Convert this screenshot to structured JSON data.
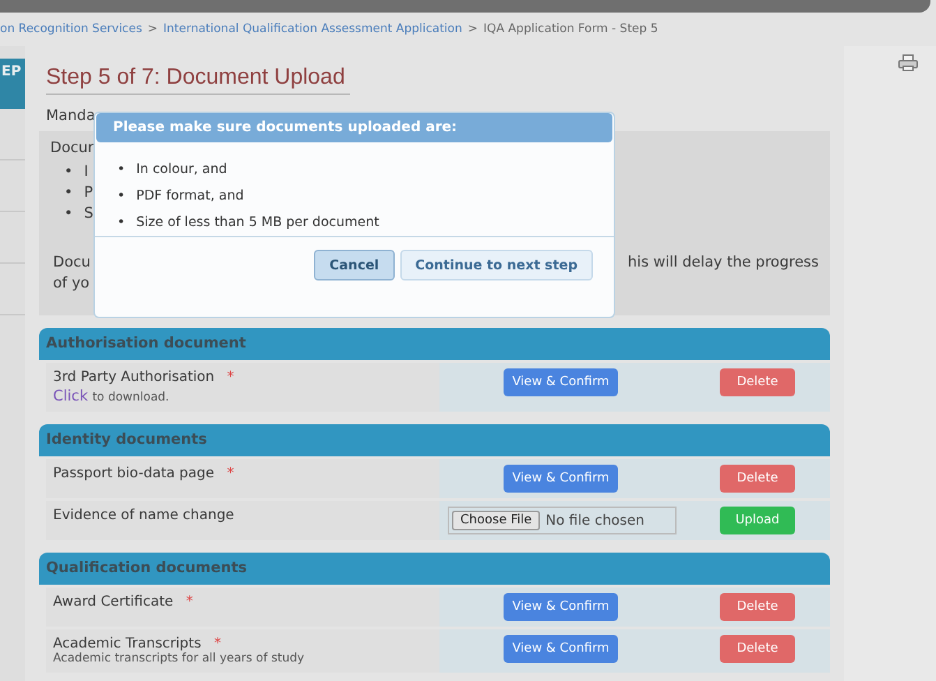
{
  "breadcrumb": [
    {
      "label": "on Recognition Services",
      "kind": "link"
    },
    {
      "label": ">",
      "kind": "separator"
    },
    {
      "label": "International Qualification Assessment Application",
      "kind": "link"
    },
    {
      "label": ">",
      "kind": "separator"
    },
    {
      "label": "IQA Application Form - Step 5",
      "kind": "current"
    }
  ],
  "sidebar": {
    "label": "EP"
  },
  "page_title": "Step 5 of 7: Document Upload",
  "mandatory_fragment": "Manda",
  "info": {
    "heading_fragment": "Docur",
    "bullet_fragments": [
      {
        "marker": "•",
        "text": "I"
      },
      {
        "marker": "•",
        "text": "P"
      },
      {
        "marker": "•",
        "text": "S"
      }
    ],
    "note_fragment_start": "Docu",
    "note_fragment_end": "his will delay the progress",
    "note_fragment_line2": "of yo"
  },
  "sections": [
    {
      "title": "Authorisation document",
      "rows": [
        {
          "kind": "document",
          "label": "3rd Party Authorisation",
          "asterisk": "*",
          "link": "Click",
          "hint": "to download.",
          "view_button": "View & Confirm",
          "delete_button": "Delete"
        }
      ]
    },
    {
      "title": "Identity documents",
      "rows": [
        {
          "kind": "document",
          "label": "Passport bio-data page",
          "asterisk": "*",
          "view_button": "View & Confirm",
          "delete_button": "Delete"
        },
        {
          "kind": "upload",
          "label": "Evidence of name change",
          "choose_button": "Choose File",
          "file_status": "No file chosen",
          "upload_button": "Upload"
        }
      ]
    },
    {
      "title": "Qualification documents",
      "rows": [
        {
          "kind": "document",
          "label": "Award Certificate",
          "asterisk": "*",
          "view_button": "View & Confirm",
          "delete_button": "Delete"
        },
        {
          "kind": "document",
          "label": "Academic Transcripts",
          "asterisk": "*",
          "note": "Academic transcripts for all years of study",
          "view_button": "View & Confirm",
          "delete_button": "Delete"
        }
      ]
    }
  ],
  "modal": {
    "title": "Please make sure documents uploaded are:",
    "items": [
      {
        "marker": "•",
        "text": "In colour, and"
      },
      {
        "marker": "•",
        "text": "PDF format, and"
      },
      {
        "marker": "•",
        "text": "Size of less than 5 MB per document"
      }
    ],
    "buttons": [
      {
        "label": "Cancel",
        "focused": true
      },
      {
        "label": "Continue to next step",
        "focused": false
      }
    ]
  }
}
